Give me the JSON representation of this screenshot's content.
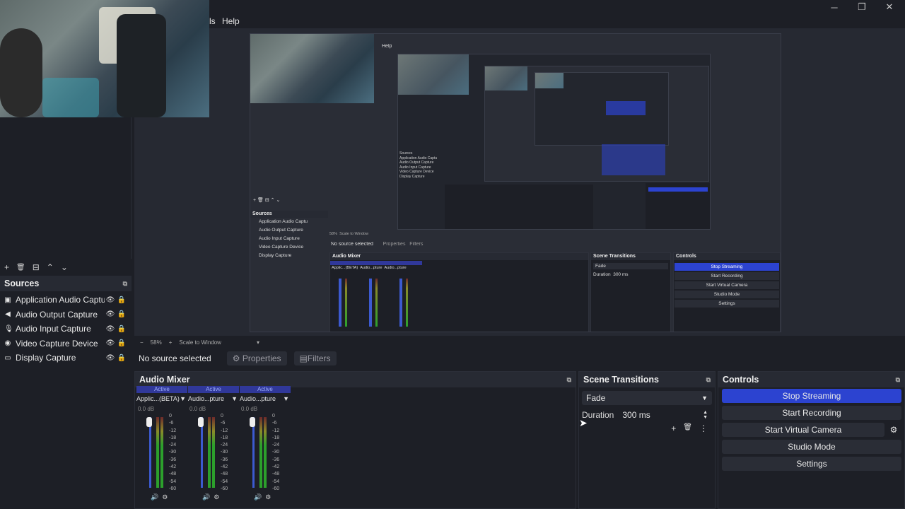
{
  "window": {
    "controls": {
      "minimize": "─",
      "maximize": "❐",
      "close": "✕"
    }
  },
  "menubar": {
    "tools_tail": "ls",
    "help": "Help"
  },
  "preview": {
    "nested": {
      "help": "Help",
      "sources_title": "Sources",
      "no_source": "No source selected",
      "properties": "Properties",
      "filters": "Filters",
      "zoom": "58%",
      "scale": "Scale to Window",
      "audio_mixer": "Audio Mixer",
      "scene_transitions": "Scene Transitions",
      "controls": "Controls",
      "fade": "Fade",
      "duration_label": "Duration",
      "duration_value": "300 ms",
      "buttons": [
        "Stop Streaming",
        "Start Recording",
        "Start Virtual Camera",
        "Studio Mode",
        "Settings"
      ],
      "sources": [
        "Application Audio Captu",
        "Audio Output Capture",
        "Audio Input Capture",
        "Video Capture Device",
        "Display Capture"
      ],
      "mix_active": "Active",
      "mix_names": [
        "Applic...(BETA)",
        "Audio...pture",
        "Audio...pture"
      ],
      "mix_db": "0.0 dB"
    }
  },
  "zoombar": {
    "minus": "−",
    "zoom": "58%",
    "plus": "+",
    "scale": "Scale to Window"
  },
  "sources_toolbar": {
    "add": "+",
    "remove": "🗑",
    "props": "⊟",
    "up": "⌃",
    "down": "⌄"
  },
  "sources": {
    "title": "Sources",
    "items": [
      {
        "label": "Application Audio Captu",
        "icon": "app-audio-icon"
      },
      {
        "label": "Audio Output Capture",
        "icon": "speaker-icon"
      },
      {
        "label": "Audio Input Capture",
        "icon": "microphone-icon"
      },
      {
        "label": "Video Capture Device",
        "icon": "camera-icon"
      },
      {
        "label": "Display Capture",
        "icon": "monitor-icon"
      }
    ]
  },
  "context": {
    "no_source": "No source selected",
    "properties": "Properties",
    "filters": "Filters"
  },
  "mixer": {
    "title": "Audio Mixer",
    "active_label": "Active",
    "channels": [
      {
        "name": "Applic...(BETA)",
        "db": "0.0 dB"
      },
      {
        "name": "Audio...pture",
        "db": "0.0 dB"
      },
      {
        "name": "Audio...pture",
        "db": "0.0 dB"
      }
    ],
    "ticks": [
      "0",
      "-6",
      "-12",
      "-18",
      "-24",
      "-30",
      "-36",
      "-42",
      "-48",
      "-54",
      "-60"
    ]
  },
  "transitions": {
    "title": "Scene Transitions",
    "selected": "Fade",
    "duration_label": "Duration",
    "duration_value": "300 ms"
  },
  "controls": {
    "title": "Controls",
    "stop_streaming": "Stop Streaming",
    "start_recording": "Start Recording",
    "start_virtual_camera": "Start Virtual Camera",
    "studio_mode": "Studio Mode",
    "settings": "Settings",
    "accent": "#2c43d0"
  }
}
